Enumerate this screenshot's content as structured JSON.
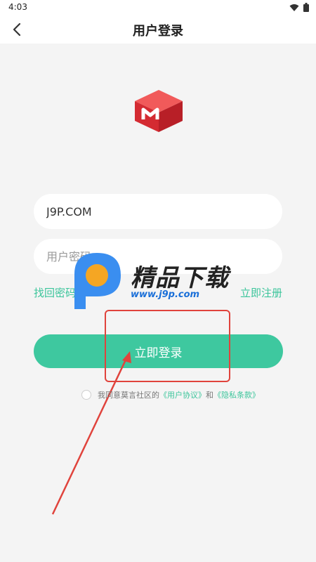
{
  "status_bar": {
    "time": "4:03",
    "icons": [
      "wifi-icon",
      "battery-icon"
    ]
  },
  "header": {
    "title": "用户登录",
    "back_icon": "chevron-left-icon"
  },
  "form": {
    "username_value": "J9P.COM",
    "password_placeholder": "用户密码"
  },
  "links": {
    "forgot": "找回密码",
    "register": "立即注册"
  },
  "login_button": "立即登录",
  "agreement": {
    "prefix": "我同意莫言社区的",
    "user_agreement": "《用户协议》",
    "and": "和",
    "privacy": "《隐私条款》"
  },
  "watermark": {
    "brand": "精品下载",
    "url": "www.j9p.com"
  },
  "colors": {
    "accent": "#3ec89f",
    "logo_red": "#e0333a",
    "annotation_red": "#e0433c",
    "background": "#f4f4f4"
  }
}
